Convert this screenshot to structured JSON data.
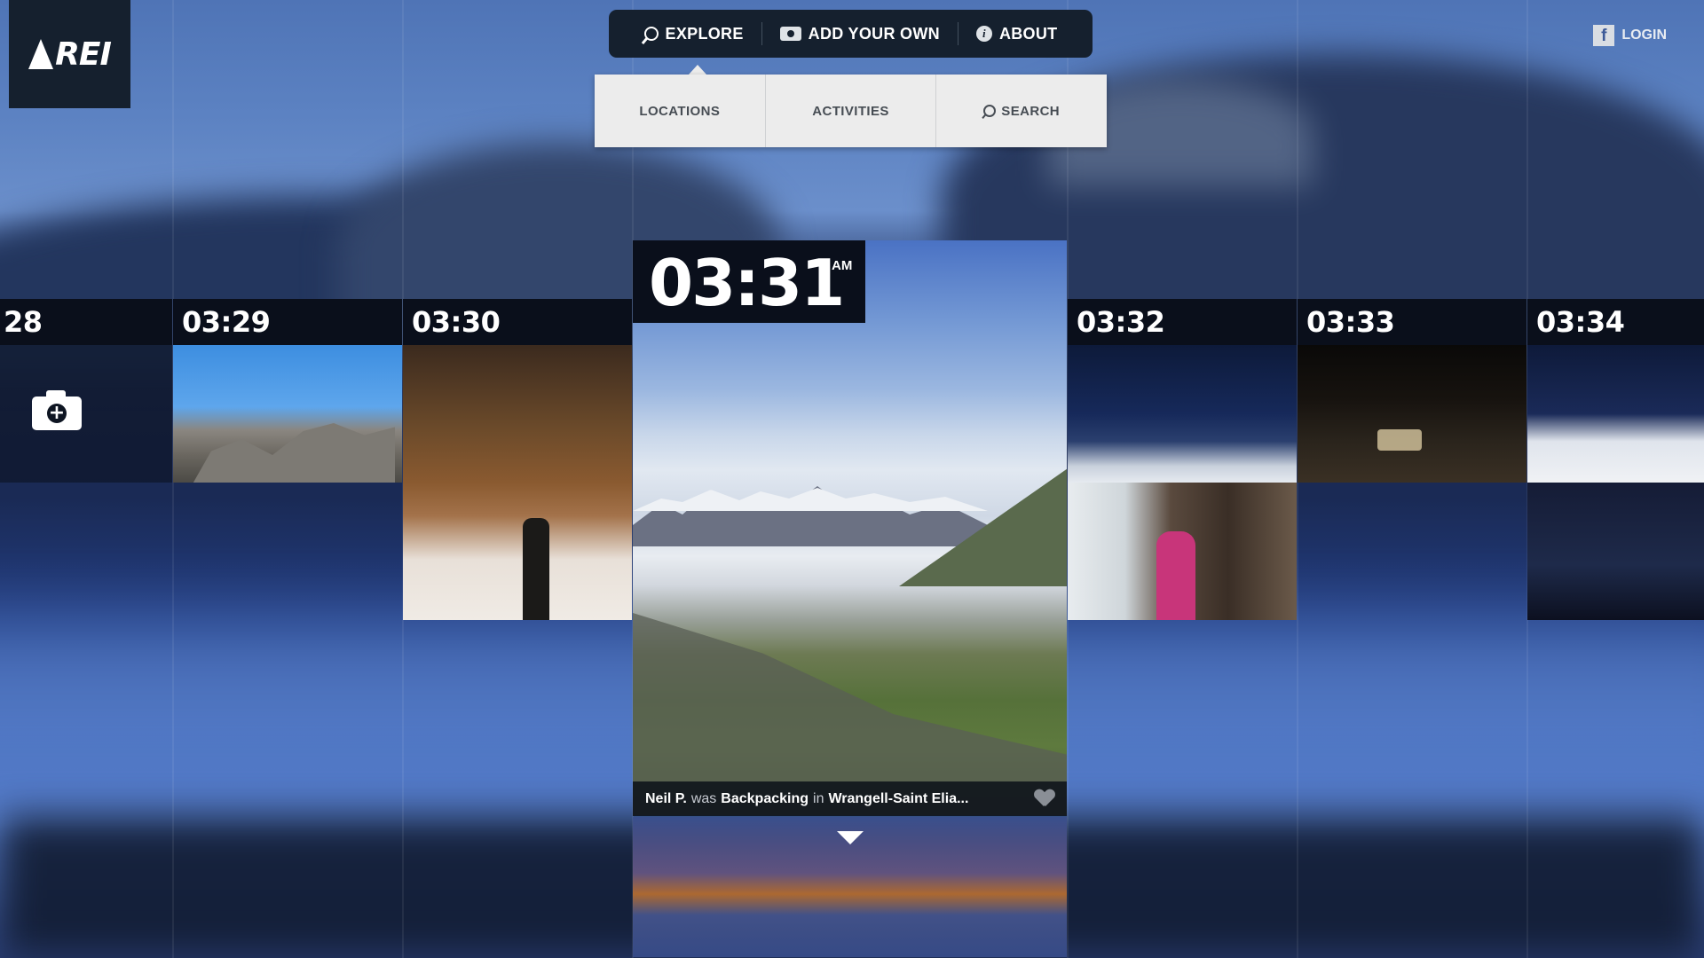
{
  "brand": {
    "logo_text": "REI"
  },
  "topnav": {
    "explore": "EXPLORE",
    "add_your_own": "ADD YOUR OWN",
    "about": "ABOUT"
  },
  "subnav": {
    "locations": "LOCATIONS",
    "activities": "ACTIVITIES",
    "search": "SEARCH"
  },
  "account": {
    "login": "LOGIN",
    "fb_icon": "f"
  },
  "timeline": {
    "col_prev": "28",
    "col_1": "03:29",
    "col_2": "03:30",
    "col_4": "03:32",
    "col_5": "03:33",
    "col_6": "03:34"
  },
  "featured": {
    "time": "03:31",
    "ampm": "AM",
    "user": "Neil P.",
    "was": "was",
    "activity": "Backpacking",
    "in": "in",
    "location": "Wrangell-Saint Elia..."
  },
  "colors": {
    "nav_bg": "#15202e",
    "subnav_bg": "#ececec",
    "time_bar": "#0a0f1b"
  }
}
